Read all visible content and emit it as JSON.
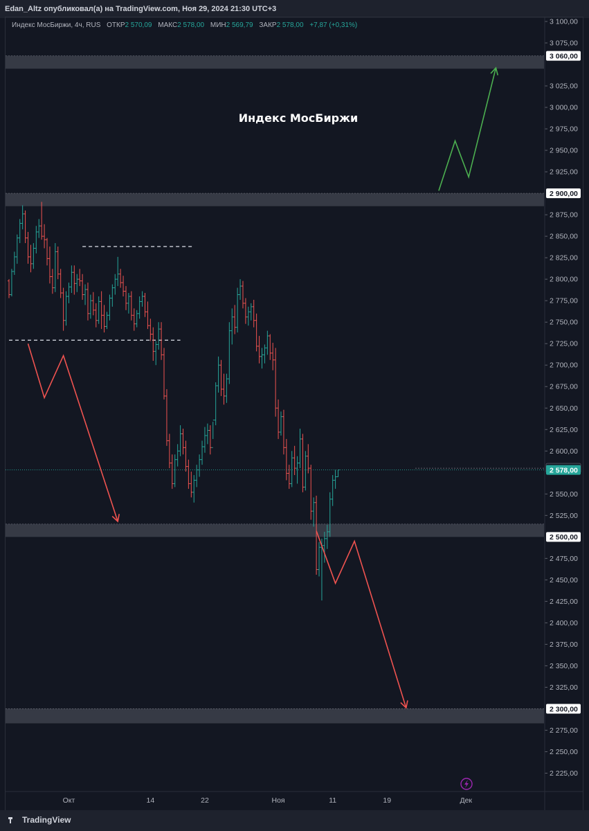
{
  "header": {
    "publisher": "Edan_Altz опубликовал(а) на TradingView.com, Ноя 29, 2024 21:30 UTC+3"
  },
  "legend": {
    "symbol": "Индекс МосБиржи, 4ч, RUS",
    "open_label": "ОТКР",
    "open": "2 570,09",
    "high_label": "МАКС",
    "high": "2 578,00",
    "low_label": "МИН",
    "low": "2 569,79",
    "close_label": "ЗАКР",
    "close": "2 578,00",
    "change": "+7,87 (+0,31%)"
  },
  "chart_data": {
    "type": "candlestick",
    "title": "Индекс МосБиржи",
    "ylim": [
      2200,
      3100
    ],
    "y_ticks": [
      {
        "v": 3100,
        "t": "3 100,00"
      },
      {
        "v": 3075,
        "t": "3 075,00"
      },
      {
        "v": 3025,
        "t": "3 025,00"
      },
      {
        "v": 3000,
        "t": "3 000,00"
      },
      {
        "v": 2975,
        "t": "2 975,00"
      },
      {
        "v": 2950,
        "t": "2 950,00"
      },
      {
        "v": 2925,
        "t": "2 925,00"
      },
      {
        "v": 2875,
        "t": "2 875,00"
      },
      {
        "v": 2850,
        "t": "2 850,00"
      },
      {
        "v": 2825,
        "t": "2 825,00"
      },
      {
        "v": 2800,
        "t": "2 800,00"
      },
      {
        "v": 2775,
        "t": "2 775,00"
      },
      {
        "v": 2750,
        "t": "2 750,00"
      },
      {
        "v": 2725,
        "t": "2 725,00"
      },
      {
        "v": 2700,
        "t": "2 700,00"
      },
      {
        "v": 2675,
        "t": "2 675,00"
      },
      {
        "v": 2650,
        "t": "2 650,00"
      },
      {
        "v": 2625,
        "t": "2 625,00"
      },
      {
        "v": 2600,
        "t": "2 600,00"
      },
      {
        "v": 2550,
        "t": "2 550,00"
      },
      {
        "v": 2525,
        "t": "2 525,00"
      },
      {
        "v": 2475,
        "t": "2 475,00"
      },
      {
        "v": 2450,
        "t": "2 450,00"
      },
      {
        "v": 2425,
        "t": "2 425,00"
      },
      {
        "v": 2400,
        "t": "2 400,00"
      },
      {
        "v": 2375,
        "t": "2 375,00"
      },
      {
        "v": 2350,
        "t": "2 350,00"
      },
      {
        "v": 2325,
        "t": "2 325,00"
      },
      {
        "v": 2275,
        "t": "2 275,00"
      },
      {
        "v": 2250,
        "t": "2 250,00"
      },
      {
        "v": 2225,
        "t": "2 225,00"
      }
    ],
    "x_ticks": [
      {
        "i": 22,
        "t": "Окт"
      },
      {
        "i": 52,
        "t": "14"
      },
      {
        "i": 72,
        "t": "22"
      },
      {
        "i": 99,
        "t": "Ноя"
      },
      {
        "i": 119,
        "t": "11"
      },
      {
        "i": 139,
        "t": "19"
      },
      {
        "i": 168,
        "t": "Дек"
      }
    ],
    "price_tags": [
      {
        "v": 3060,
        "t": "3 060,00",
        "bg": "#ffffff",
        "fg": "#131722"
      },
      {
        "v": 2900,
        "t": "2 900,00",
        "bg": "#ffffff",
        "fg": "#131722"
      },
      {
        "v": 2580,
        "t": "2 580,00",
        "bg": "#131722",
        "fg": "#b2b5be"
      },
      {
        "v": 2578,
        "t": "2 578,00",
        "bg": "#26a69a",
        "fg": "#ffffff"
      },
      {
        "v": 2500,
        "t": "2 500,00",
        "bg": "#ffffff",
        "fg": "#131722"
      },
      {
        "v": 2300,
        "t": "2 300,00",
        "bg": "#ffffff",
        "fg": "#131722"
      }
    ],
    "zones": [
      {
        "from": 3045,
        "to": 3060
      },
      {
        "from": 2885,
        "to": 2900
      },
      {
        "from": 2500,
        "to": 2515
      },
      {
        "from": 2283,
        "to": 2300
      }
    ],
    "dashed_levels": [
      {
        "v": 2838,
        "from_i": 27,
        "to_i": 68
      },
      {
        "v": 2729,
        "from_i": 0,
        "to_i": 63
      }
    ],
    "current_price": 2578,
    "annotation_paths": [
      {
        "color": "#ef5350",
        "points": [
          [
            7,
            2725
          ],
          [
            13,
            2662
          ],
          [
            20,
            2711
          ],
          [
            40,
            2518
          ]
        ],
        "arrow": true
      },
      {
        "color": "#ef5350",
        "points": [
          [
            113,
            2507
          ],
          [
            120,
            2446
          ],
          [
            127,
            2495
          ],
          [
            146,
            2301
          ]
        ],
        "arrow": true
      },
      {
        "color": "#4caf50",
        "points": [
          [
            158,
            2903
          ],
          [
            164,
            2961
          ],
          [
            169,
            2919
          ],
          [
            179,
            3046
          ]
        ],
        "arrow": true
      }
    ],
    "candles": [
      [
        2798,
        2800,
        2778,
        2782
      ],
      [
        2782,
        2812,
        2780,
        2809
      ],
      [
        2809,
        2832,
        2805,
        2826
      ],
      [
        2826,
        2852,
        2818,
        2848
      ],
      [
        2848,
        2870,
        2842,
        2865
      ],
      [
        2865,
        2886,
        2858,
        2876
      ],
      [
        2876,
        2880,
        2842,
        2848
      ],
      [
        2848,
        2855,
        2818,
        2826
      ],
      [
        2826,
        2840,
        2808,
        2818
      ],
      [
        2818,
        2842,
        2812,
        2836
      ],
      [
        2836,
        2862,
        2830,
        2855
      ],
      [
        2855,
        2870,
        2848,
        2862
      ],
      [
        2862,
        2890,
        2846,
        2850
      ],
      [
        2850,
        2864,
        2836,
        2846
      ],
      [
        2846,
        2848,
        2816,
        2824
      ],
      [
        2824,
        2838,
        2795,
        2803
      ],
      [
        2803,
        2812,
        2783,
        2790
      ],
      [
        2790,
        2842,
        2785,
        2832
      ],
      [
        2832,
        2838,
        2800,
        2806
      ],
      [
        2806,
        2812,
        2778,
        2784
      ],
      [
        2784,
        2790,
        2740,
        2752
      ],
      [
        2752,
        2786,
        2746,
        2780
      ],
      [
        2780,
        2796,
        2772,
        2791
      ],
      [
        2791,
        2816,
        2784,
        2808
      ],
      [
        2808,
        2816,
        2782,
        2795
      ],
      [
        2795,
        2806,
        2785,
        2800
      ],
      [
        2800,
        2812,
        2792,
        2798
      ],
      [
        2798,
        2806,
        2776,
        2782
      ],
      [
        2782,
        2794,
        2770,
        2788
      ],
      [
        2788,
        2796,
        2752,
        2760
      ],
      [
        2760,
        2782,
        2754,
        2775
      ],
      [
        2775,
        2785,
        2758,
        2764
      ],
      [
        2764,
        2772,
        2744,
        2752
      ],
      [
        2752,
        2780,
        2748,
        2774
      ],
      [
        2774,
        2786,
        2742,
        2758
      ],
      [
        2758,
        2770,
        2738,
        2745
      ],
      [
        2745,
        2762,
        2742,
        2758
      ],
      [
        2758,
        2782,
        2752,
        2778
      ],
      [
        2778,
        2794,
        2768,
        2790
      ],
      [
        2790,
        2806,
        2782,
        2800
      ],
      [
        2800,
        2826,
        2792,
        2806
      ],
      [
        2806,
        2812,
        2790,
        2796
      ],
      [
        2796,
        2804,
        2780,
        2786
      ],
      [
        2786,
        2792,
        2764,
        2772
      ],
      [
        2772,
        2784,
        2760,
        2780
      ],
      [
        2780,
        2786,
        2752,
        2758
      ],
      [
        2758,
        2766,
        2740,
        2748
      ],
      [
        2748,
        2764,
        2744,
        2760
      ],
      [
        2760,
        2780,
        2754,
        2774
      ],
      [
        2774,
        2786,
        2768,
        2780
      ],
      [
        2780,
        2784,
        2756,
        2762
      ],
      [
        2762,
        2774,
        2742,
        2746
      ],
      [
        2746,
        2754,
        2728,
        2736
      ],
      [
        2736,
        2744,
        2705,
        2716
      ],
      [
        2716,
        2728,
        2700,
        2724
      ],
      [
        2724,
        2750,
        2718,
        2742
      ],
      [
        2742,
        2750,
        2706,
        2712
      ],
      [
        2712,
        2720,
        2660,
        2664
      ],
      [
        2664,
        2672,
        2606,
        2612
      ],
      [
        2612,
        2620,
        2580,
        2586
      ],
      [
        2586,
        2596,
        2556,
        2562
      ],
      [
        2562,
        2596,
        2558,
        2590
      ],
      [
        2590,
        2608,
        2582,
        2600
      ],
      [
        2600,
        2630,
        2594,
        2620
      ],
      [
        2620,
        2626,
        2596,
        2604
      ],
      [
        2604,
        2612,
        2576,
        2582
      ],
      [
        2582,
        2590,
        2556,
        2562
      ],
      [
        2562,
        2576,
        2546,
        2552
      ],
      [
        2552,
        2572,
        2540,
        2566
      ],
      [
        2566,
        2584,
        2558,
        2578
      ],
      [
        2578,
        2596,
        2570,
        2590
      ],
      [
        2590,
        2612,
        2584,
        2605
      ],
      [
        2605,
        2628,
        2598,
        2618
      ],
      [
        2618,
        2632,
        2608,
        2624
      ],
      [
        2624,
        2630,
        2596,
        2604
      ],
      [
        2604,
        2614,
        2634,
        2636
      ],
      [
        2636,
        2680,
        2630,
        2676
      ],
      [
        2676,
        2710,
        2668,
        2700
      ],
      [
        2700,
        2706,
        2664,
        2672
      ],
      [
        2672,
        2690,
        2654,
        2664
      ],
      [
        2664,
        2690,
        2656,
        2684
      ],
      [
        2684,
        2750,
        2678,
        2740
      ],
      [
        2740,
        2766,
        2724,
        2756
      ],
      [
        2756,
        2770,
        2736,
        2744
      ],
      [
        2744,
        2790,
        2738,
        2782
      ],
      [
        2782,
        2800,
        2776,
        2792
      ],
      [
        2792,
        2798,
        2766,
        2772
      ],
      [
        2772,
        2778,
        2748,
        2756
      ],
      [
        2756,
        2768,
        2746,
        2762
      ],
      [
        2762,
        2772,
        2752,
        2768
      ],
      [
        2768,
        2776,
        2744,
        2752
      ],
      [
        2752,
        2760,
        2716,
        2722
      ],
      [
        2722,
        2734,
        2702,
        2710
      ],
      [
        2710,
        2720,
        2696,
        2712
      ],
      [
        2712,
        2724,
        2702,
        2720
      ],
      [
        2720,
        2740,
        2712,
        2734
      ],
      [
        2734,
        2736,
        2706,
        2714
      ],
      [
        2714,
        2726,
        2694,
        2706
      ],
      [
        2706,
        2720,
        2640,
        2650
      ],
      [
        2650,
        2660,
        2614,
        2622
      ],
      [
        2622,
        2646,
        2618,
        2640
      ],
      [
        2640,
        2648,
        2596,
        2604
      ],
      [
        2604,
        2614,
        2566,
        2574
      ],
      [
        2574,
        2584,
        2556,
        2562
      ],
      [
        2562,
        2600,
        2558,
        2592
      ],
      [
        2592,
        2606,
        2572,
        2580
      ],
      [
        2580,
        2594,
        2562,
        2586
      ],
      [
        2586,
        2626,
        2580,
        2614
      ],
      [
        2614,
        2620,
        2552,
        2558
      ],
      [
        2558,
        2600,
        2554,
        2594
      ],
      [
        2594,
        2608,
        2574,
        2580
      ],
      [
        2580,
        2584,
        2520,
        2530
      ],
      [
        2530,
        2546,
        2512,
        2540
      ],
      [
        2540,
        2548,
        2456,
        2462
      ],
      [
        2462,
        2494,
        2454,
        2488
      ],
      [
        2488,
        2498,
        2426,
        2490
      ],
      [
        2490,
        2506,
        2470,
        2498
      ],
      [
        2498,
        2514,
        2486,
        2506
      ],
      [
        2506,
        2552,
        2500,
        2544
      ],
      [
        2544,
        2572,
        2536,
        2566
      ],
      [
        2566,
        2578,
        2556,
        2570
      ],
      [
        2570,
        2578,
        2569.79,
        2578
      ]
    ]
  }
}
